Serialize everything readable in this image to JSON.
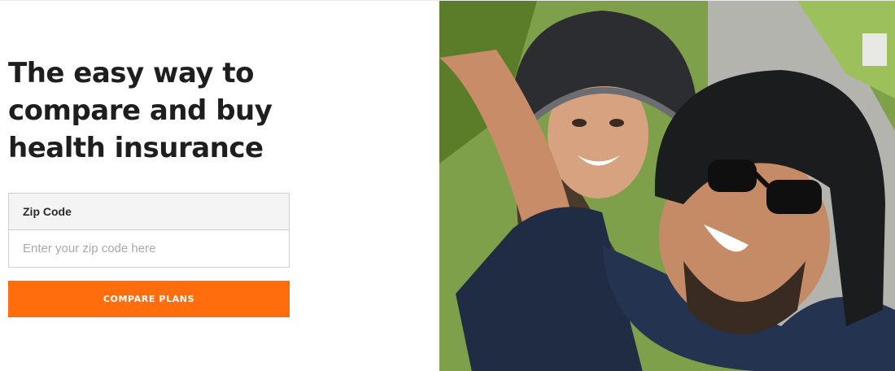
{
  "hero": {
    "headline_lines": [
      "The easy way to",
      "compare and buy",
      "health insurance"
    ]
  },
  "zip": {
    "label": "Zip Code",
    "placeholder": "Enter your zip code here",
    "value": ""
  },
  "cta": {
    "label": "COMPARE PLANS"
  },
  "colors": {
    "accent": "#ff6d0d",
    "headline": "#1e1e1e",
    "label_bg": "#f4f4f4"
  }
}
